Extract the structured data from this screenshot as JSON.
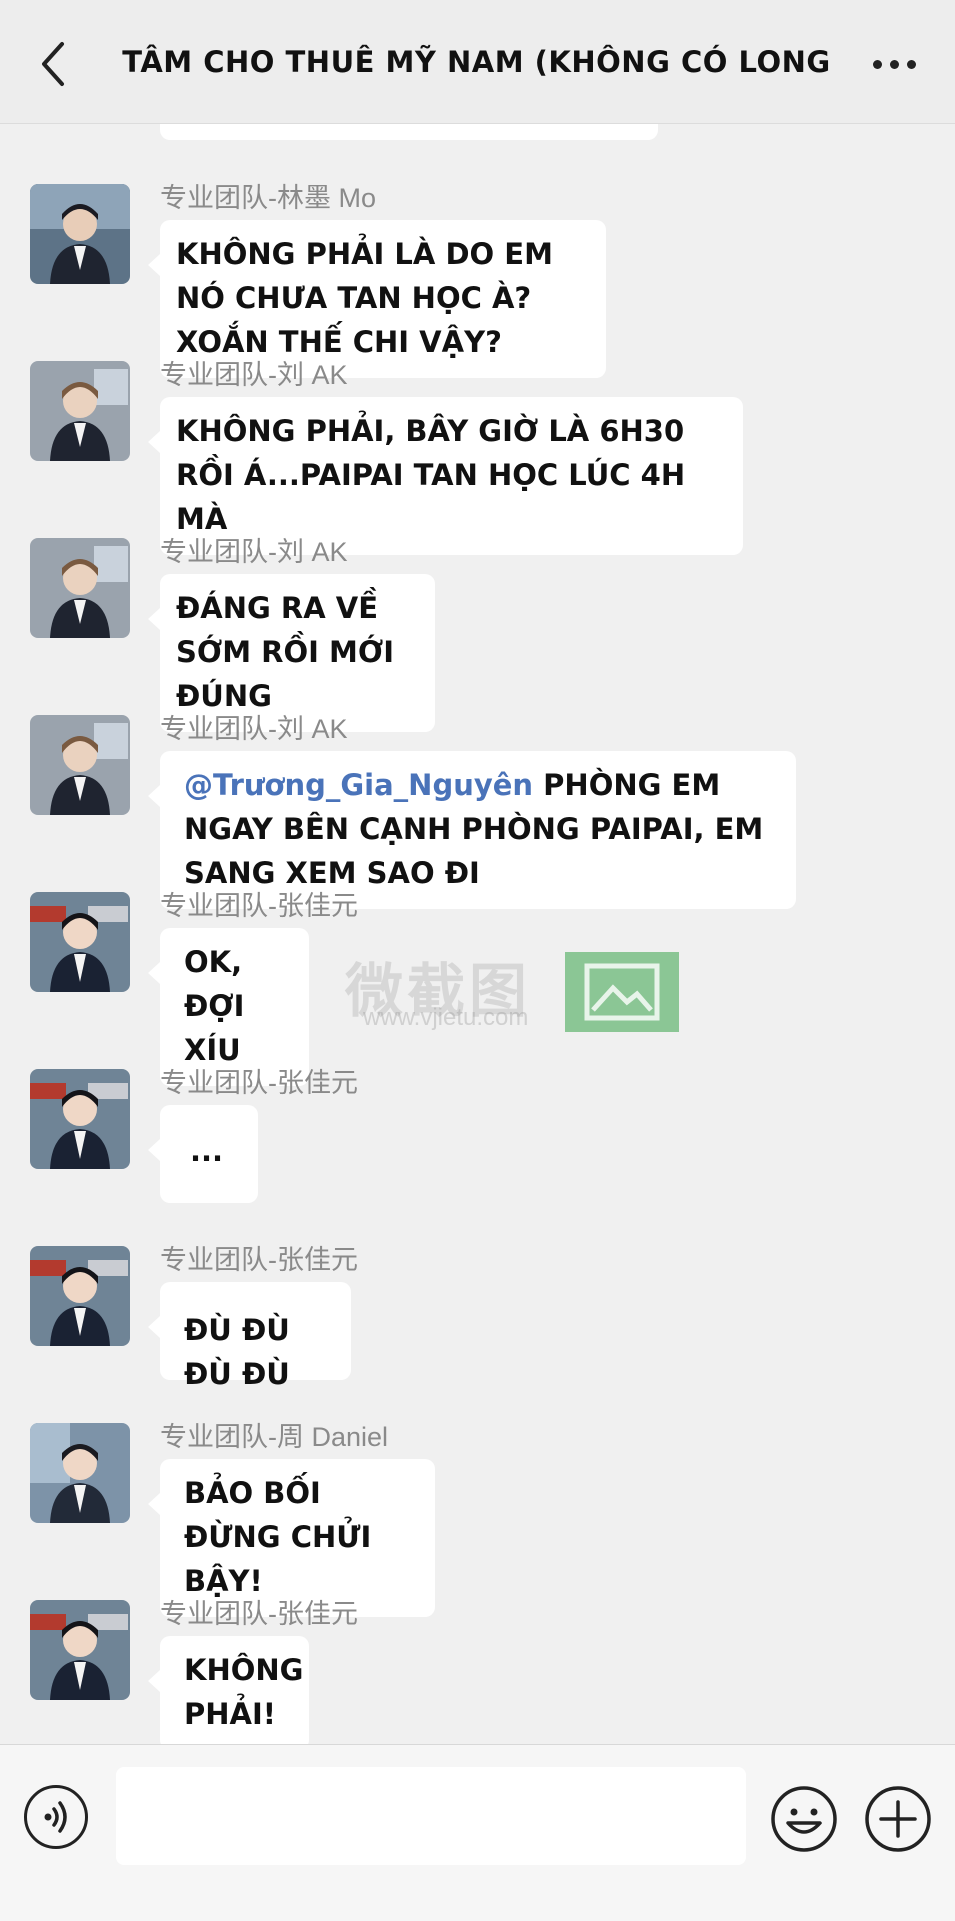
{
  "header": {
    "back_icon": "chevron-left-icon",
    "title": "Trung tâm cho thuê mỹ nam (không có Long Tổng)",
    "more_icon": "more-dots-icon"
  },
  "watermark": {
    "text": "微截图",
    "url": "www.vjietu.com"
  },
  "messages": [
    {
      "sender": "专业团队-林墨 Mo",
      "text": "Không phải là do em nó chưa tan học à? Xoắn thế chi vậy?"
    },
    {
      "sender": "专业团队-刘 AK",
      "text": "Không phải, bây giờ là 6h30 rồi á...Paipai tan học lúc 4h mà"
    },
    {
      "sender": "专业团队-刘 AK",
      "text": "Đáng ra về sớm rồi mới đúng"
    },
    {
      "sender": "专业团队-刘 AK",
      "mention": "@Trương_Gia_Nguyên",
      "text": " phòng em ngay bên cạnh phòng Paipai, em sang xem sao đi"
    },
    {
      "sender": "专业团队-张佳元",
      "text": "Ok, đợi xíu"
    },
    {
      "sender": "专业团队-张佳元",
      "text": "..."
    },
    {
      "sender": "专业团队-张佳元",
      "text": "Đù đù đù đù"
    },
    {
      "sender": "专业团队-周 Daniel",
      "text": "Bảo bối đừng chửi bậy!"
    },
    {
      "sender": "专业团队-张佳元",
      "text": "Không phải!"
    }
  ],
  "input_bar": {
    "voice_icon": "voice-icon",
    "input_value": "",
    "emoji_icon": "emoji-icon",
    "plus_icon": "plus-icon"
  }
}
